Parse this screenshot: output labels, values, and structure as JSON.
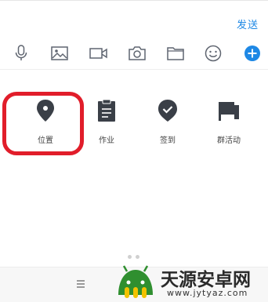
{
  "header": {
    "send_label": "发送"
  },
  "toolbar": {
    "icons": [
      "microphone-icon",
      "image-icon",
      "video-icon",
      "camera-icon",
      "folder-icon",
      "emoji-icon",
      "plus-icon"
    ]
  },
  "actions": [
    {
      "label": "位置",
      "icon": "location-pin-icon"
    },
    {
      "label": "作业",
      "icon": "clipboard-icon"
    },
    {
      "label": "签到",
      "icon": "checkin-icon"
    },
    {
      "label": "群活动",
      "icon": "flag-icon"
    }
  ],
  "colors": {
    "accent": "#1e88e5",
    "highlight": "#e11d2a",
    "icon": "#3a3f47"
  },
  "watermark": {
    "text": "天源安卓网",
    "url": "www.jytyaz.com"
  }
}
